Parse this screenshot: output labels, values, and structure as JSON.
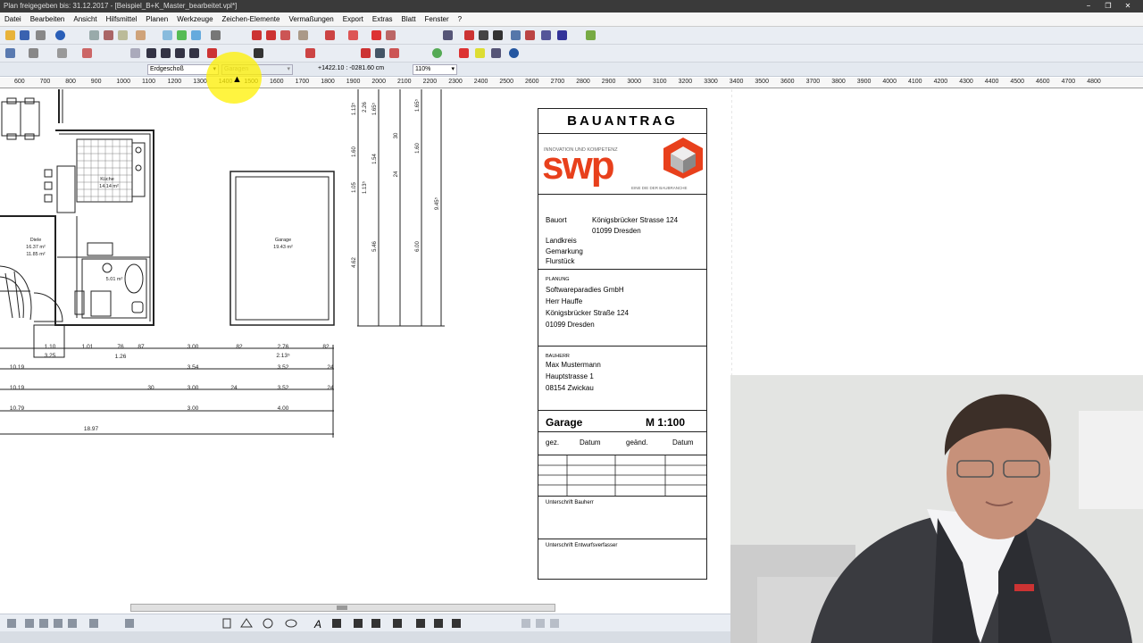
{
  "window": {
    "title": "Plan freigegeben bis: 31.12.2017 - [Beispiel_B+K_Master_bearbeitet.vpl*]",
    "controls": [
      "−",
      "❐",
      "✕"
    ]
  },
  "menu": [
    "Datei",
    "Bearbeiten",
    "Ansicht",
    "Hilfsmittel",
    "Planen",
    "Werkzeuge",
    "Zeichen-Elemente",
    "Vermaßungen",
    "Export",
    "Extras",
    "Blatt",
    "Fenster",
    "?"
  ],
  "propbar": {
    "floor": "Erdgeschoß",
    "layer": "Garagen",
    "coords": "+1422.10 : -0281.60 cm",
    "zoom": "110%"
  },
  "ruler": [
    "600",
    "700",
    "800",
    "900",
    "1000",
    "1100",
    "1200",
    "1300",
    "1400",
    "1500",
    "1600",
    "1700",
    "1800",
    "1900",
    "2000",
    "2100",
    "2200",
    "2300",
    "2400",
    "2500",
    "2600",
    "2700",
    "2800",
    "2900",
    "3000",
    "3100",
    "3200",
    "3300",
    "3400",
    "3500",
    "3600",
    "3700",
    "3800",
    "3900",
    "4000",
    "4100",
    "4200",
    "4300",
    "4400",
    "4500",
    "4600",
    "4700",
    "4800"
  ],
  "rooms": {
    "kueche": {
      "name": "Küche",
      "area": "14.14 m²"
    },
    "diele": {
      "name": "Diele",
      "area1": "16.37 m²",
      "area2": "11.85 m²"
    },
    "bad": {
      "area": "5.01 m²"
    },
    "garage": {
      "name": "Garage",
      "area": "19.43 m²"
    }
  },
  "dims": {
    "row1": [
      "1.10",
      "1.01",
      "76",
      "87",
      "3.00",
      "82",
      "2.76",
      "82"
    ],
    "row1b": [
      "3.25",
      "1.26",
      "2.13⁵"
    ],
    "row2": [
      "10.19",
      "3.54",
      "3.52",
      "24"
    ],
    "row3": [
      "10.19",
      "30",
      "3.00",
      "24",
      "3.52",
      "24"
    ],
    "row4": [
      "10.79",
      "3.00",
      "4.00"
    ],
    "row5": [
      "18.97"
    ],
    "vert1": [
      "1.13⁵",
      "1.60",
      "1.05",
      "4.62"
    ],
    "vert2": [
      "2.26",
      "1.13⁵",
      "5.46"
    ],
    "vert3": [
      "1.65⁵",
      "1.54",
      "30"
    ],
    "vert4": [
      "30",
      "24",
      "1.60",
      "6.00"
    ],
    "vert5": [
      "1.65⁵",
      "9.45⁵"
    ]
  },
  "titleblock": {
    "heading": "BAUANTRAG",
    "logo": {
      "tagline": "INNOVATION UND KOMPETENZ",
      "brand": "swp",
      "subtag": "EINE DIE DER BAUBRANCHE",
      "color": "#e8401c"
    },
    "bauort_label": "Bauort",
    "bauort_value1": "Königsbrücker Strasse 124",
    "bauort_value2": "01099 Dresden",
    "landkreis": "Landkreis",
    "gemarkung": "Gemarkung",
    "flurstueck": "Flurstück",
    "planung_label": "PLANUNG",
    "planung": [
      "Softwareparadies GmbH",
      "Herr Hauffe",
      "Königsbrücker Straße 124",
      "01099 Dresden"
    ],
    "bauherr_label": "BAUHERR",
    "bauherr": [
      "Max Mustermann",
      "Hauptstrasse 1",
      "08154 Zwickau"
    ],
    "drawing": "Garage",
    "scale": "M 1:100",
    "cols": [
      "gez.",
      "Datum",
      "geänd.",
      "Datum"
    ],
    "sig1": "Unterschrift Bauherr",
    "sig2": "Unterschrift Entwurfsverfasser"
  }
}
